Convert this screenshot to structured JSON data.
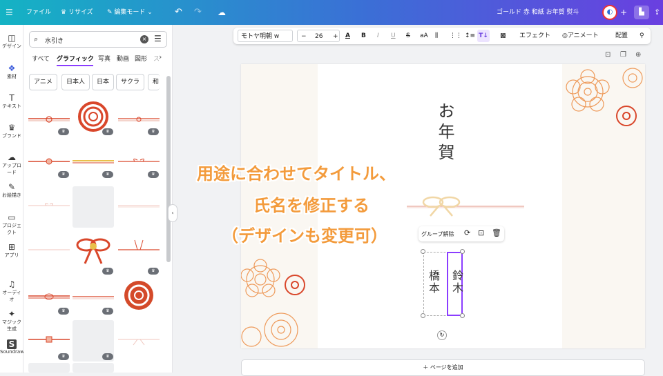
{
  "topbar": {
    "file": "ファイル",
    "resize": "リサイズ",
    "edit_mode": "編集モード",
    "doc_title": "ゴールド 赤 和紙 お年賀 熨斗"
  },
  "rail": [
    {
      "label": "デザイン",
      "icon": "layout-icon",
      "glyph": "◫"
    },
    {
      "label": "素材",
      "icon": "elements-icon",
      "glyph": "❖"
    },
    {
      "label": "テキスト",
      "icon": "text-icon",
      "glyph": "T"
    },
    {
      "label": "ブランド",
      "icon": "brand-icon",
      "glyph": "♛"
    },
    {
      "label": "アップロード",
      "icon": "upload-icon",
      "glyph": "☁"
    },
    {
      "label": "お絵描き",
      "icon": "draw-icon",
      "glyph": "✎"
    },
    {
      "label": "プロジェクト",
      "icon": "folder-icon",
      "glyph": "▭"
    },
    {
      "label": "アプリ",
      "icon": "apps-icon",
      "glyph": "⊞"
    },
    {
      "label": "オーディオ",
      "icon": "audio-icon",
      "glyph": "♫"
    },
    {
      "label": "マジック生成",
      "icon": "magic-media-icon",
      "glyph": "✦"
    },
    {
      "label": "Soundraw",
      "icon": "soundraw-icon",
      "glyph": "S"
    }
  ],
  "panel": {
    "search_value": "水引き",
    "tabs": [
      "すべて",
      "グラフィック",
      "写真",
      "動画",
      "図形",
      "ス"
    ],
    "active_tab": 1,
    "chips": [
      "アニメ",
      "日本人",
      "日本",
      "サクラ",
      "和"
    ]
  },
  "toolbar": {
    "font": "モトヤ明朝 w",
    "font_size": "26",
    "effects": "エフェクト",
    "animate": "アニメート",
    "position": "配置"
  },
  "canvas": {
    "title": "お年賀",
    "name_left": "橋本",
    "name_right": "鈴木",
    "context_ungroup": "グループ解除"
  },
  "overlay": {
    "line1": "用途に合わせてタイトル、",
    "line2": "氏名を修正する",
    "line3": "（デザインも変更可）"
  },
  "add_page": "＋ ページを追加",
  "colors": {
    "accent_purple": "#8b3dff",
    "overlay_orange": "#f39b3c",
    "mizuhiki_red": "#d9472b",
    "flower_orange": "#ee9a5a"
  }
}
